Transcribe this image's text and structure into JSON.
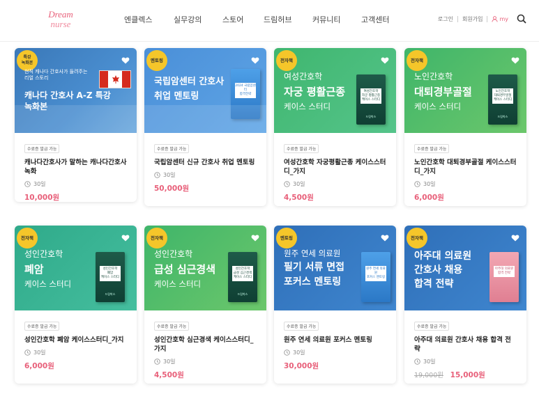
{
  "header": {
    "logo_line1": "Dream",
    "logo_line2": "nurse",
    "nav": [
      "엔클렉스",
      "실무강의",
      "스토어",
      "드림허브",
      "커뮤니티",
      "고객센터"
    ],
    "util": {
      "login": "로그인",
      "signup": "회원가입",
      "my": "my"
    }
  },
  "colors": {
    "accent": "#e8607a",
    "badge": "#f5c62a"
  },
  "cards": [
    {
      "badge": "특강\n녹화본",
      "thumb_sub": "현직 캐나다 간호사가 들려주는\n리얼 스토리",
      "thumb_title": "캐나다 간호사 A-Z 특강\n녹화본",
      "tag": "수료증 발급 가능",
      "name": "캐나다간호사가 말하는 캐나다간호사 녹화",
      "duration": "30일",
      "price": "10,000원"
    },
    {
      "badge": "멘토링",
      "thumb_title": "국립암센터 간호사\n취업 멘토링",
      "book_label": "2024 국립암센터\n합격전략",
      "tag": "수료증 발급 가능",
      "name": "국립암센터 신규 간호사 취업 멘토링",
      "duration": "30일",
      "price": "50,000원"
    },
    {
      "badge": "전자책",
      "thumb_sub_top": "여성간호학",
      "thumb_title": "자궁 평활근종",
      "thumb_sub_bottom": "케이스 스터디",
      "book_label": "여성간호학\n자궁 평활근종\n케이스 스터디",
      "book_foot": "드림박스",
      "tag": "수료증 발급 가능",
      "name": "여성간호학 자궁평활근종 케이스스터디_가지",
      "duration": "30일",
      "price": "4,500원"
    },
    {
      "badge": "전자책",
      "thumb_sub_top": "노인간호학",
      "thumb_title": "대퇴경부골절",
      "thumb_sub_bottom": "케이스 스터디",
      "book_label": "노인간호학\n대퇴경부골절\n케이스 스터디",
      "book_foot": "드림박스",
      "tag": "수료증 발급 가능",
      "name": "노인간호학 대퇴경부골절 케이스스터디_가지",
      "duration": "30일",
      "price": "6,000원"
    },
    {
      "badge": "전자책",
      "thumb_sub_top": "성인간호학",
      "thumb_title": "폐암",
      "thumb_sub_bottom": "케이스 스터디",
      "book_label": "성인간호학\n폐암\n케이스 스터디",
      "book_foot": "드림박스",
      "tag": "수료증 발급 가능",
      "name": "성인간호학 폐암 케이스스터디_가지",
      "duration": "30일",
      "price": "6,000원"
    },
    {
      "badge": "전자책",
      "thumb_sub_top": "성인간호학",
      "thumb_title": "급성 심근경색",
      "thumb_sub_bottom": "케이스 스터디",
      "book_label": "성인간호학\n급성 심근경색\n케이스 스터디",
      "book_foot": "드림박스",
      "tag": "수료증 발급 가능",
      "name": "성인간호학 심근경색 케이스스터디_가지",
      "duration": "30일",
      "price": "4,500원"
    },
    {
      "badge": "멘토링",
      "thumb_sub_top": "원주 연세 의료원",
      "thumb_title": "필기 서류 면접\n포커스 멘토링",
      "book_label": "원주 연세 의료원\n포커스 멘토링",
      "tag": "수료증 발급 가능",
      "name": "원주 연세 의료원 포커스 멘토링",
      "duration": "30일",
      "price": "30,000원"
    },
    {
      "badge": "전자책",
      "thumb_title": "아주대 의료원\n간호사 채용\n합격 전략",
      "book_label": "아주대 의료원\n합격 전략",
      "tag": "수료증 발급 가능",
      "name": "아주대 의료원 간호사 채용 합격 전략",
      "duration": "30일",
      "price_old": "19,000원",
      "price": "15,000원"
    }
  ]
}
